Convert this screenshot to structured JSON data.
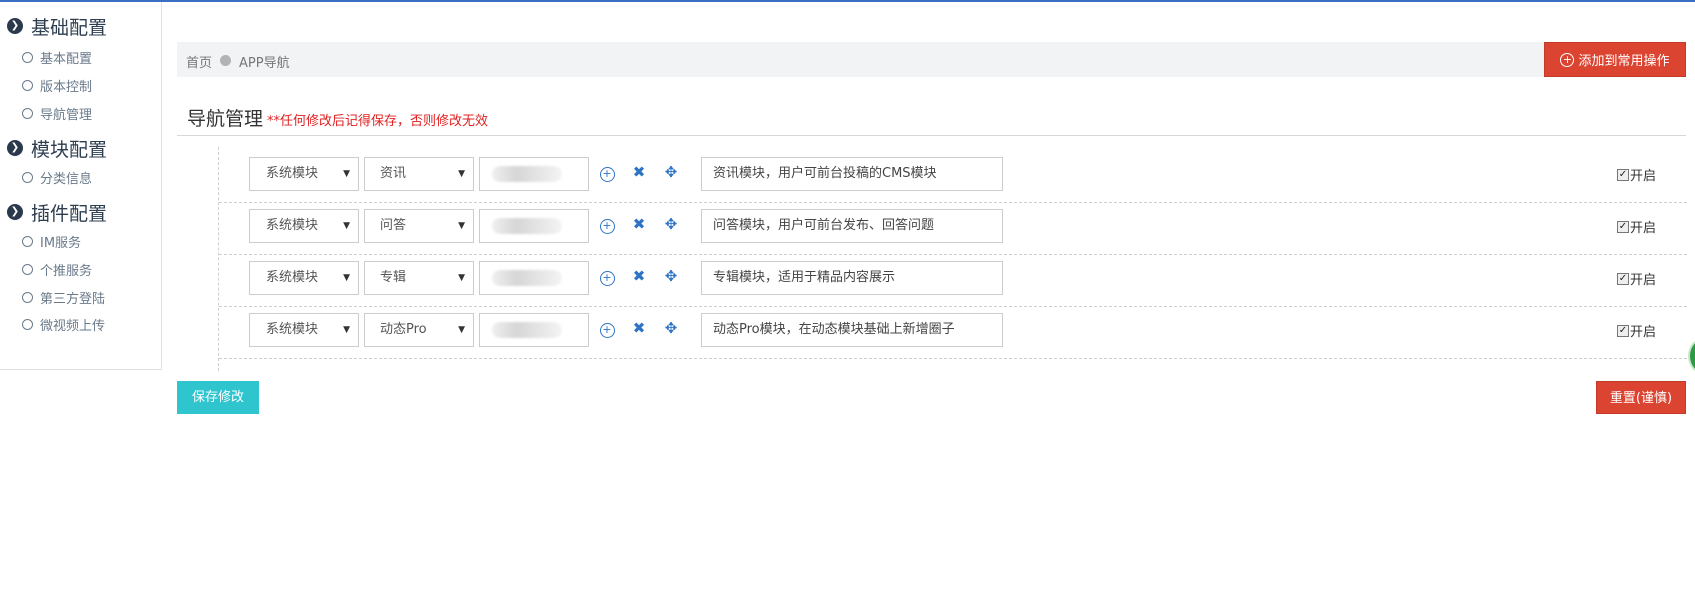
{
  "sidebar": {
    "groups": [
      {
        "title": "基础配置",
        "icon": "chevron-down-circle-icon",
        "items": [
          {
            "label": "基本配置"
          },
          {
            "label": "版本控制"
          },
          {
            "label": "导航管理"
          }
        ]
      },
      {
        "title": "模块配置",
        "icon": "chevron-down-circle-icon",
        "items": [
          {
            "label": "分类信息"
          }
        ]
      },
      {
        "title": "插件配置",
        "icon": "chevron-down-circle-icon",
        "items": [
          {
            "label": "IM服务"
          },
          {
            "label": "个推服务"
          },
          {
            "label": "第三方登陆"
          },
          {
            "label": "微视频上传"
          }
        ]
      }
    ]
  },
  "breadcrumb": {
    "home": "首页",
    "current": "APP导航"
  },
  "header": {
    "add_common_label": "添加到常用操作"
  },
  "section": {
    "title": "导航管理",
    "warning": "**任何修改后记得保存，否则修改无效"
  },
  "rows": [
    {
      "type": "系统模块",
      "module": "资讯",
      "description": "资讯模块，用户可前台投稿的CMS模块",
      "enabled_label": "开启",
      "enabled": true
    },
    {
      "type": "系统模块",
      "module": "问答",
      "description": "问答模块，用户可前台发布、回答问题",
      "enabled_label": "开启",
      "enabled": true
    },
    {
      "type": "系统模块",
      "module": "专辑",
      "description": "专辑模块，适用于精品内容展示",
      "enabled_label": "开启",
      "enabled": true
    },
    {
      "type": "系统模块",
      "module": "动态Pro",
      "description": "动态Pro模块，在动态模块基础上新增圈子",
      "enabled_label": "开启",
      "enabled": true
    }
  ],
  "footer": {
    "save_label": "保存修改",
    "reset_label": "重置(谨慎)"
  },
  "colors": {
    "accent_red": "#dc4432",
    "save_cyan": "#2ec5cf",
    "icon_blue": "#2f73c4",
    "top_line": "#3a6fc4"
  }
}
